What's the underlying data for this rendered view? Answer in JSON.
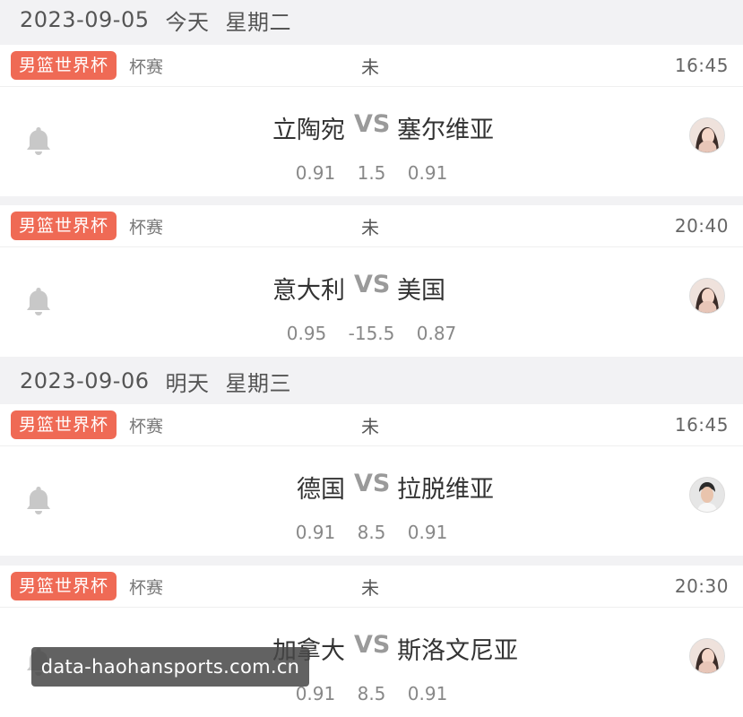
{
  "days": [
    {
      "date": "2023-09-05",
      "relative": "今天",
      "weekday": "星期二"
    },
    {
      "date": "2023-09-06",
      "relative": "明天",
      "weekday": "星期三"
    }
  ],
  "matches": [
    {
      "league": "男篮世界杯",
      "kind": "杯赛",
      "status": "未",
      "time": "16:45",
      "home": "立陶宛",
      "vs": "VS",
      "away": "塞尔维亚",
      "odds": [
        "0.91",
        "1.5",
        "0.91"
      ]
    },
    {
      "league": "男篮世界杯",
      "kind": "杯赛",
      "status": "未",
      "time": "20:40",
      "home": "意大利",
      "vs": "VS",
      "away": "美国",
      "odds": [
        "0.95",
        "-15.5",
        "0.87"
      ]
    },
    {
      "league": "男篮世界杯",
      "kind": "杯赛",
      "status": "未",
      "time": "16:45",
      "home": "德国",
      "vs": "VS",
      "away": "拉脱维亚",
      "odds": [
        "0.91",
        "8.5",
        "0.91"
      ]
    },
    {
      "league": "男篮世界杯",
      "kind": "杯赛",
      "status": "未",
      "time": "20:30",
      "home": "加拿大",
      "vs": "VS",
      "away": "斯洛文尼亚",
      "odds": [
        "0.91",
        "8.5",
        "0.91"
      ]
    }
  ],
  "icons": {
    "reminder": "bell-icon",
    "tipster": "avatar"
  },
  "colors": {
    "tag": "#ef6a55",
    "background": "#f2f2f4"
  },
  "watermark": "data-haohansports.com.cn"
}
